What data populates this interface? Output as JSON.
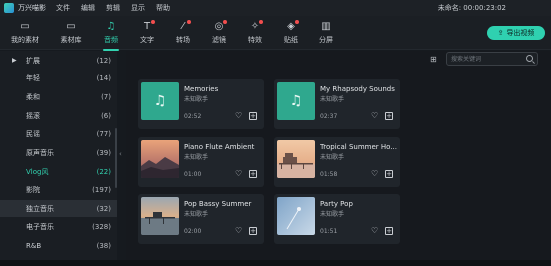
{
  "app": {
    "name": "万兴喵影",
    "menu": [
      "文件",
      "编辑",
      "剪辑",
      "显示",
      "帮助"
    ],
    "project_title": "未命名: 00:00:23:02"
  },
  "toolbar": {
    "items": [
      {
        "label": "我的素材",
        "icon": "folder-icon",
        "glyph": "▭"
      },
      {
        "label": "素材库",
        "icon": "folder-icon",
        "glyph": "▭"
      },
      {
        "label": "音频",
        "icon": "music-note-icon",
        "glyph": "♫"
      },
      {
        "label": "文字",
        "icon": "text-icon",
        "glyph": "T"
      },
      {
        "label": "转场",
        "icon": "transition-icon",
        "glyph": "⁄"
      },
      {
        "label": "滤镜",
        "icon": "filter-icon",
        "glyph": "◎"
      },
      {
        "label": "特效",
        "icon": "effects-icon",
        "glyph": "✧"
      },
      {
        "label": "贴纸",
        "icon": "sticker-icon",
        "glyph": "◈"
      },
      {
        "label": "分屏",
        "icon": "split-screen-icon",
        "glyph": "▥"
      }
    ],
    "active_index": 2,
    "export_label": "导出视频"
  },
  "sidebar": {
    "categories": [
      {
        "name": "扩展",
        "count": "(12)"
      },
      {
        "name": "年轻",
        "count": "(14)"
      },
      {
        "name": "柔和",
        "count": "(7)"
      },
      {
        "name": "摇滚",
        "count": "(6)"
      },
      {
        "name": "民谣",
        "count": "(77)"
      },
      {
        "name": "原声音乐",
        "count": "(39)"
      },
      {
        "name": "Vlog风",
        "count": "(22)"
      },
      {
        "name": "影院",
        "count": "(197)"
      },
      {
        "name": "独立音乐",
        "count": "(32)"
      },
      {
        "name": "电子音乐",
        "count": "(328)"
      },
      {
        "name": "R&B",
        "count": "(38)"
      }
    ],
    "selected_index": 6,
    "highlight_index": 8
  },
  "search": {
    "placeholder": "搜索关键词"
  },
  "tracks": [
    {
      "title": "Memories",
      "artist": "未知歌手",
      "duration": "02:52",
      "thumb": "music"
    },
    {
      "title": "My Rhapsody Sounds",
      "artist": "未知歌手",
      "duration": "02:37",
      "thumb": "music"
    },
    {
      "title": "Piano Flute Ambient",
      "artist": "未知歌手",
      "duration": "01:00",
      "thumb": "sunset-hills"
    },
    {
      "title": "Tropical Summer Ho...",
      "artist": "未知歌手",
      "duration": "01:58",
      "thumb": "pier-sunset"
    },
    {
      "title": "Pop Bassy Summer",
      "artist": "未知歌手",
      "duration": "02:00",
      "thumb": "pier-dusk"
    },
    {
      "title": "Party Pop",
      "artist": "未知歌手",
      "duration": "01:51",
      "thumb": "blue-sky"
    }
  ],
  "colors": {
    "accent": "#32d2b0",
    "badge": "#f24e4e",
    "background": "#161a1f"
  }
}
